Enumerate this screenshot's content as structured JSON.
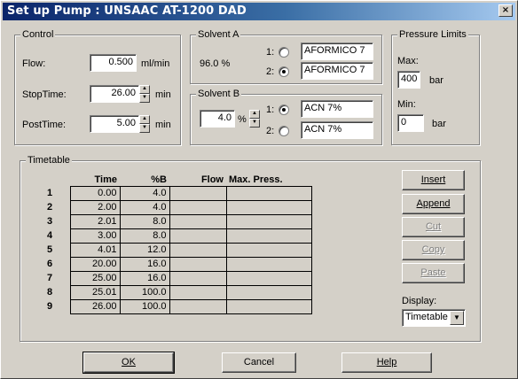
{
  "window": {
    "title": "Set up Pump : UNSAAC  AT-1200 DAD",
    "close_glyph": "×"
  },
  "control": {
    "legend": "Control",
    "flow_label": "Flow:",
    "flow_value": "0.500",
    "flow_unit": "ml/min",
    "stoptime_label": "StopTime:",
    "stoptime_value": "26.00",
    "stoptime_unit": "min",
    "posttime_label": "PostTime:",
    "posttime_value": "5.00",
    "posttime_unit": "min"
  },
  "solvent_a": {
    "legend": "Solvent A",
    "percent": "96.0 %",
    "opt1_label": "1:",
    "opt1_value": "AFORMICO 7",
    "opt2_label": "2:",
    "opt2_value": "AFORMICO 7",
    "selected": 2
  },
  "solvent_b": {
    "legend": "Solvent B",
    "percent_value": "4.0",
    "percent_unit": "%",
    "opt1_label": "1:",
    "opt1_value": "ACN 7%",
    "opt2_label": "2:",
    "opt2_value": "ACN 7%",
    "selected": 1
  },
  "pressure": {
    "legend": "Pressure Limits",
    "max_label": "Max:",
    "max_value": "400",
    "max_unit": "bar",
    "min_label": "Min:",
    "min_value": "0",
    "min_unit": "bar"
  },
  "timetable": {
    "legend": "Timetable",
    "columns": [
      "Time",
      "%B",
      "Flow",
      "Max. Press."
    ],
    "rows": [
      {
        "n": "1",
        "time": "0.00",
        "b": "4.0",
        "flow": "",
        "press": ""
      },
      {
        "n": "2",
        "time": "2.00",
        "b": "4.0",
        "flow": "",
        "press": ""
      },
      {
        "n": "3",
        "time": "2.01",
        "b": "8.0",
        "flow": "",
        "press": ""
      },
      {
        "n": "4",
        "time": "3.00",
        "b": "8.0",
        "flow": "",
        "press": ""
      },
      {
        "n": "5",
        "time": "4.01",
        "b": "12.0",
        "flow": "",
        "press": ""
      },
      {
        "n": "6",
        "time": "20.00",
        "b": "16.0",
        "flow": "",
        "press": ""
      },
      {
        "n": "7",
        "time": "25.00",
        "b": "16.0",
        "flow": "",
        "press": ""
      },
      {
        "n": "8",
        "time": "25.01",
        "b": "100.0",
        "flow": "",
        "press": ""
      },
      {
        "n": "9",
        "time": "26.00",
        "b": "100.0",
        "flow": "",
        "press": ""
      }
    ],
    "buttons": {
      "insert": "Insert",
      "append": "Append",
      "cut": "Cut",
      "copy": "Copy",
      "paste": "Paste"
    },
    "display_label": "Display:",
    "display_value": "Timetable"
  },
  "footer": {
    "ok": "OK",
    "cancel": "Cancel",
    "help": "Help"
  },
  "colors": {
    "title_start": "#0a246a",
    "title_end": "#a6caf0",
    "face": "#d4d0c8"
  }
}
